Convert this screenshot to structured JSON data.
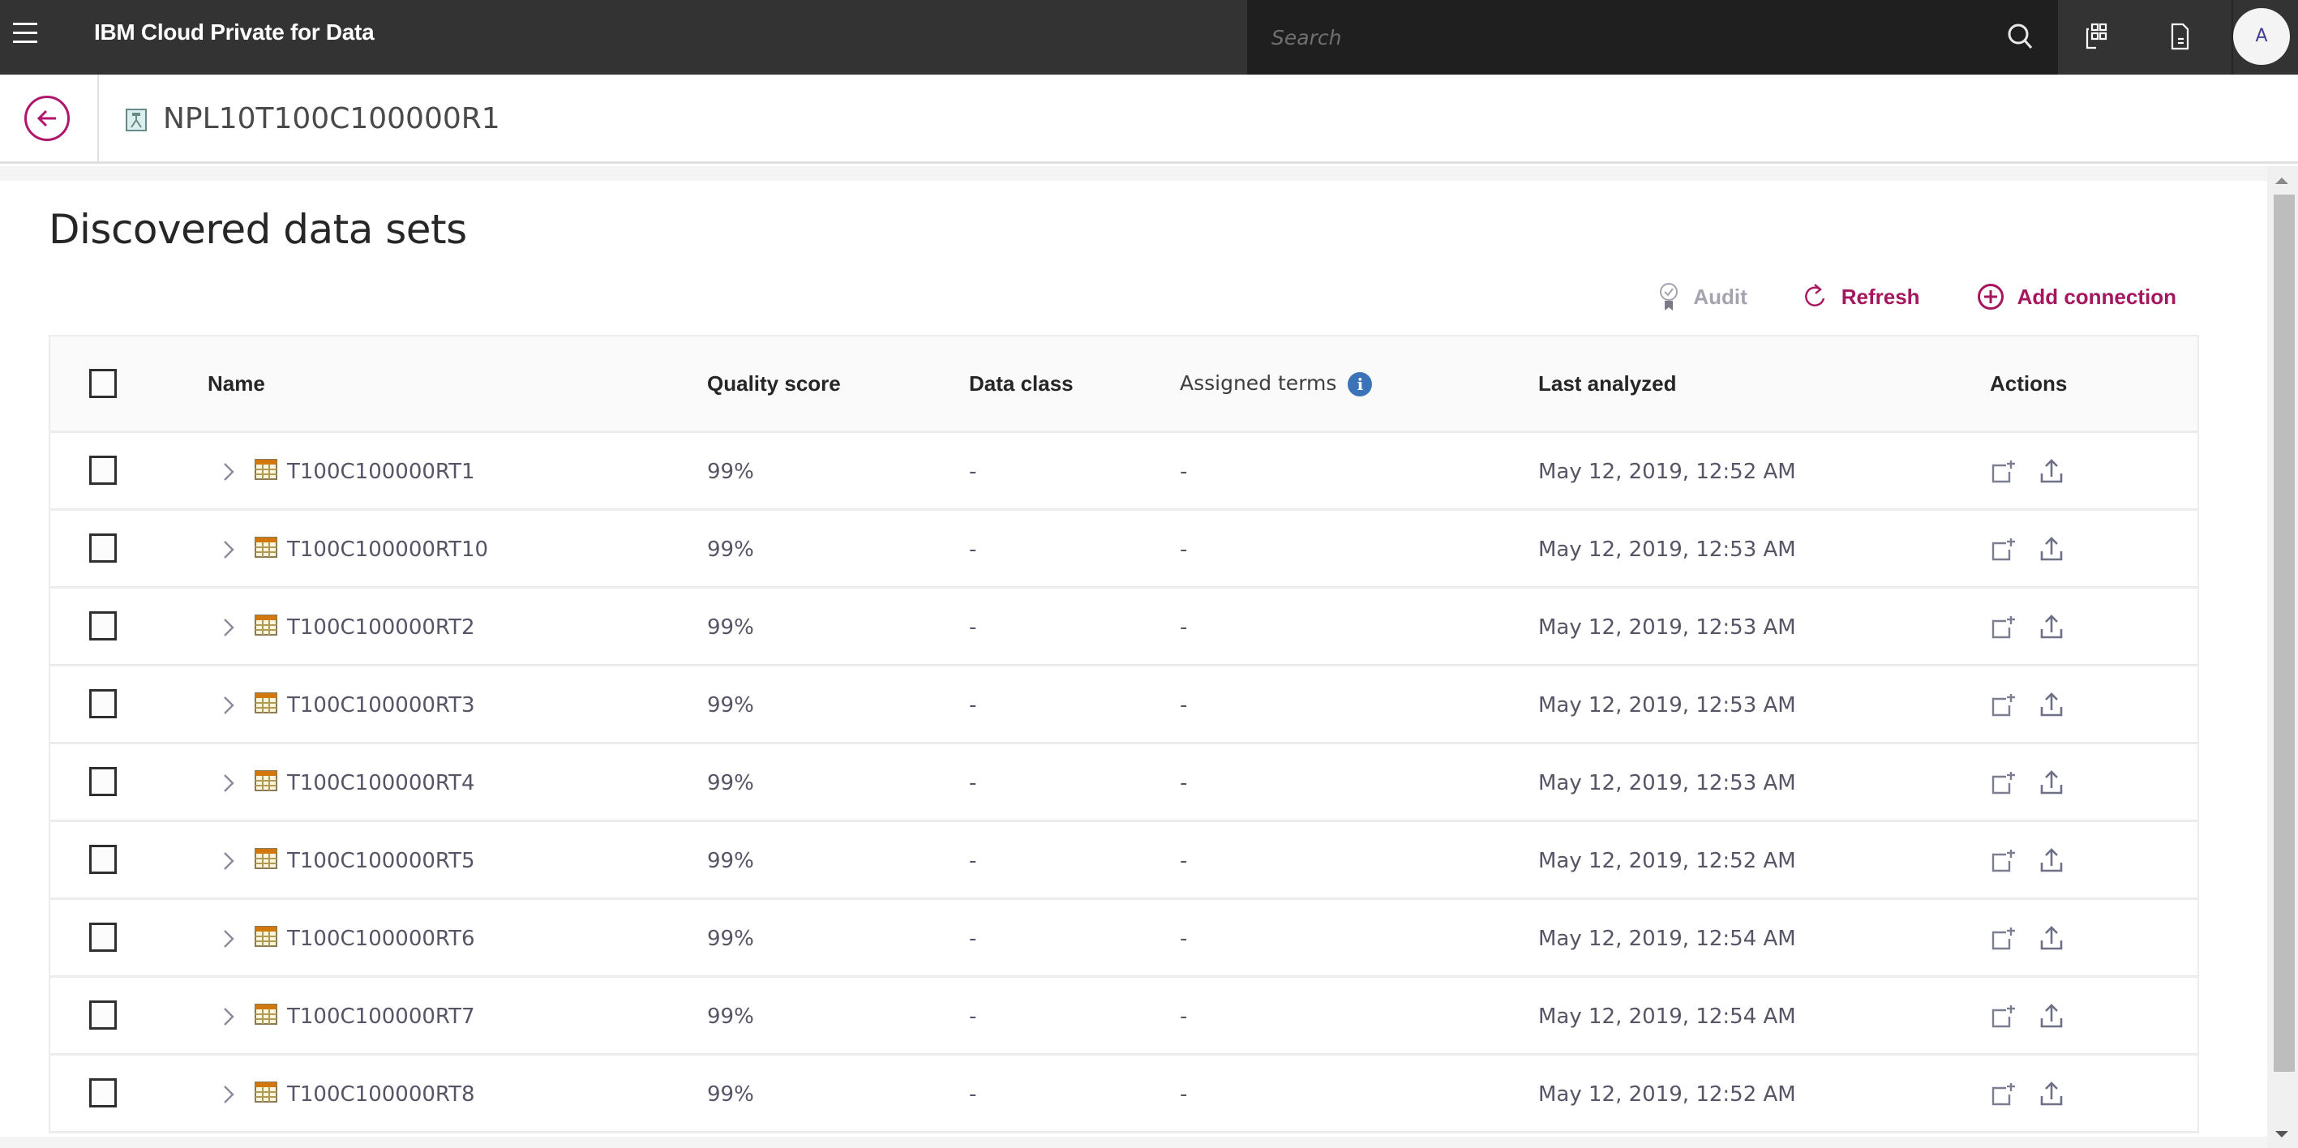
{
  "header": {
    "app_title": "IBM Cloud Private for Data",
    "search_placeholder": "Search",
    "avatar_initial": "A",
    "icons": [
      "menu-icon",
      "search-icon",
      "apps-icon",
      "document-icon"
    ]
  },
  "breadcrumb": {
    "title": "NPL10T100C100000R1",
    "back_icon": "arrow-left-icon",
    "database_icon": "database-icon"
  },
  "page": {
    "title": "Discovered data sets"
  },
  "toolbar": {
    "audit_label": "Audit",
    "refresh_label": "Refresh",
    "add_connection_label": "Add connection"
  },
  "colors": {
    "accent": "#a6165e",
    "header_bg": "#333333",
    "search_bg": "#1f1f1f",
    "info_blue": "#3b73b9",
    "disabled": "#a4a4b0"
  },
  "table": {
    "columns": {
      "name": "Name",
      "quality": "Quality score",
      "data_class": "Data class",
      "terms": "Assigned terms",
      "last_analyzed": "Last analyzed",
      "actions": "Actions"
    },
    "rows": [
      {
        "name": "T100C100000RT1",
        "quality": "99%",
        "data_class": "-",
        "terms": "-",
        "last_analyzed": "May 12, 2019, 12:52 AM"
      },
      {
        "name": "T100C100000RT10",
        "quality": "99%",
        "data_class": "-",
        "terms": "-",
        "last_analyzed": "May 12, 2019, 12:53 AM"
      },
      {
        "name": "T100C100000RT2",
        "quality": "99%",
        "data_class": "-",
        "terms": "-",
        "last_analyzed": "May 12, 2019, 12:53 AM"
      },
      {
        "name": "T100C100000RT3",
        "quality": "99%",
        "data_class": "-",
        "terms": "-",
        "last_analyzed": "May 12, 2019, 12:53 AM"
      },
      {
        "name": "T100C100000RT4",
        "quality": "99%",
        "data_class": "-",
        "terms": "-",
        "last_analyzed": "May 12, 2019, 12:53 AM"
      },
      {
        "name": "T100C100000RT5",
        "quality": "99%",
        "data_class": "-",
        "terms": "-",
        "last_analyzed": "May 12, 2019, 12:52 AM"
      },
      {
        "name": "T100C100000RT6",
        "quality": "99%",
        "data_class": "-",
        "terms": "-",
        "last_analyzed": "May 12, 2019, 12:54 AM"
      },
      {
        "name": "T100C100000RT7",
        "quality": "99%",
        "data_class": "-",
        "terms": "-",
        "last_analyzed": "May 12, 2019, 12:54 AM"
      },
      {
        "name": "T100C100000RT8",
        "quality": "99%",
        "data_class": "-",
        "terms": "-",
        "last_analyzed": "May 12, 2019, 12:52 AM"
      }
    ]
  }
}
